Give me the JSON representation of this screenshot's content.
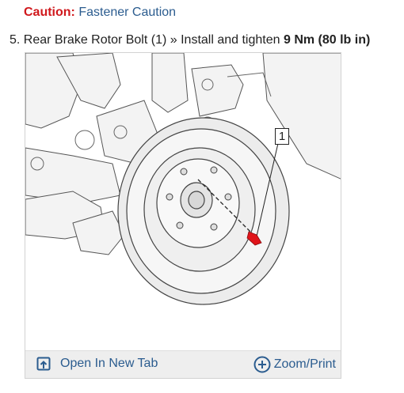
{
  "caution": {
    "label": "Caution:",
    "link": "Fastener Caution"
  },
  "step": {
    "number": "5.",
    "text": "Rear Brake Rotor Bolt (1) » Install and tighten",
    "torque": "9 Nm (80 lb in)"
  },
  "figure": {
    "callout": "1",
    "open_tab_label": "Open In New Tab",
    "zoom_label": "Zoom/Print",
    "open_tab_icon": "open-new-tab-icon",
    "zoom_icon": "plus-circle-icon",
    "link_color": "#2b5c8f",
    "bolt_color": "#e0141a"
  }
}
